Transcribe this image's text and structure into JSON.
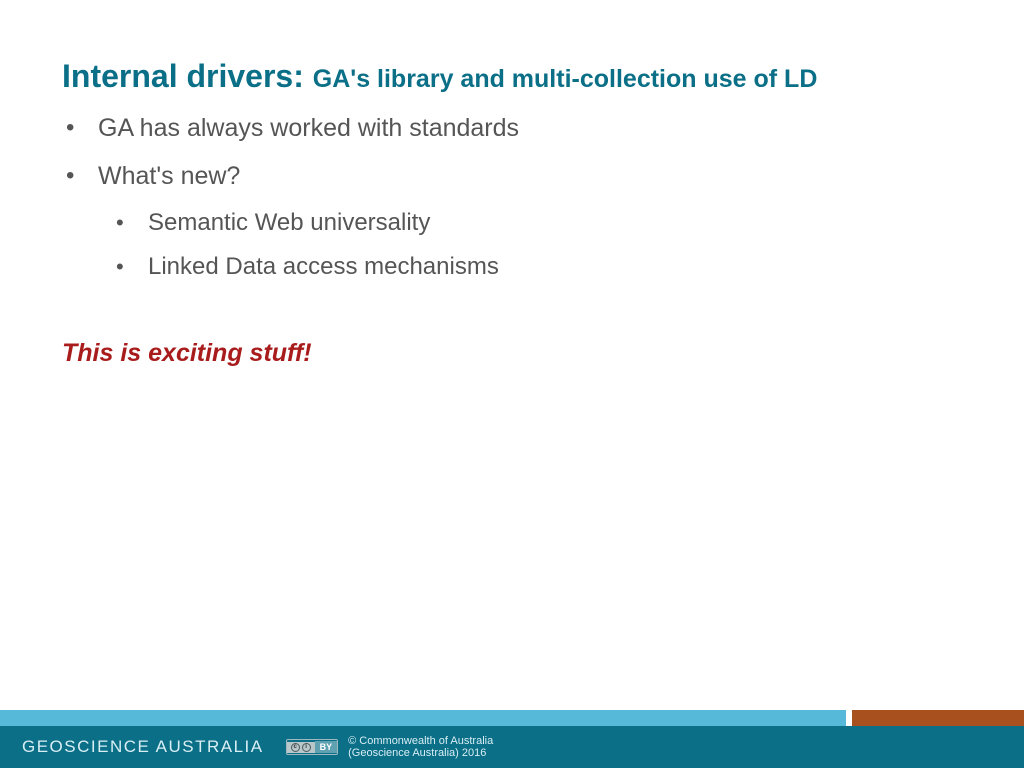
{
  "title": {
    "main": "Internal drivers: ",
    "sub": "GA's library and multi-collection use of LD"
  },
  "bullets_level1": [
    "GA has always worked with standards",
    "What's new?"
  ],
  "bullets_level2": [
    "Semantic Web universality",
    "Linked Data access mechanisms"
  ],
  "callout": "This is exciting stuff!",
  "footer": {
    "org": "GEOSCIENCE AUSTRALIA",
    "cc_left": "cc",
    "cc_right": "BY",
    "copyright_line1": "© Commonwealth of Australia",
    "copyright_line2": "(Geoscience Australia) 2016"
  }
}
